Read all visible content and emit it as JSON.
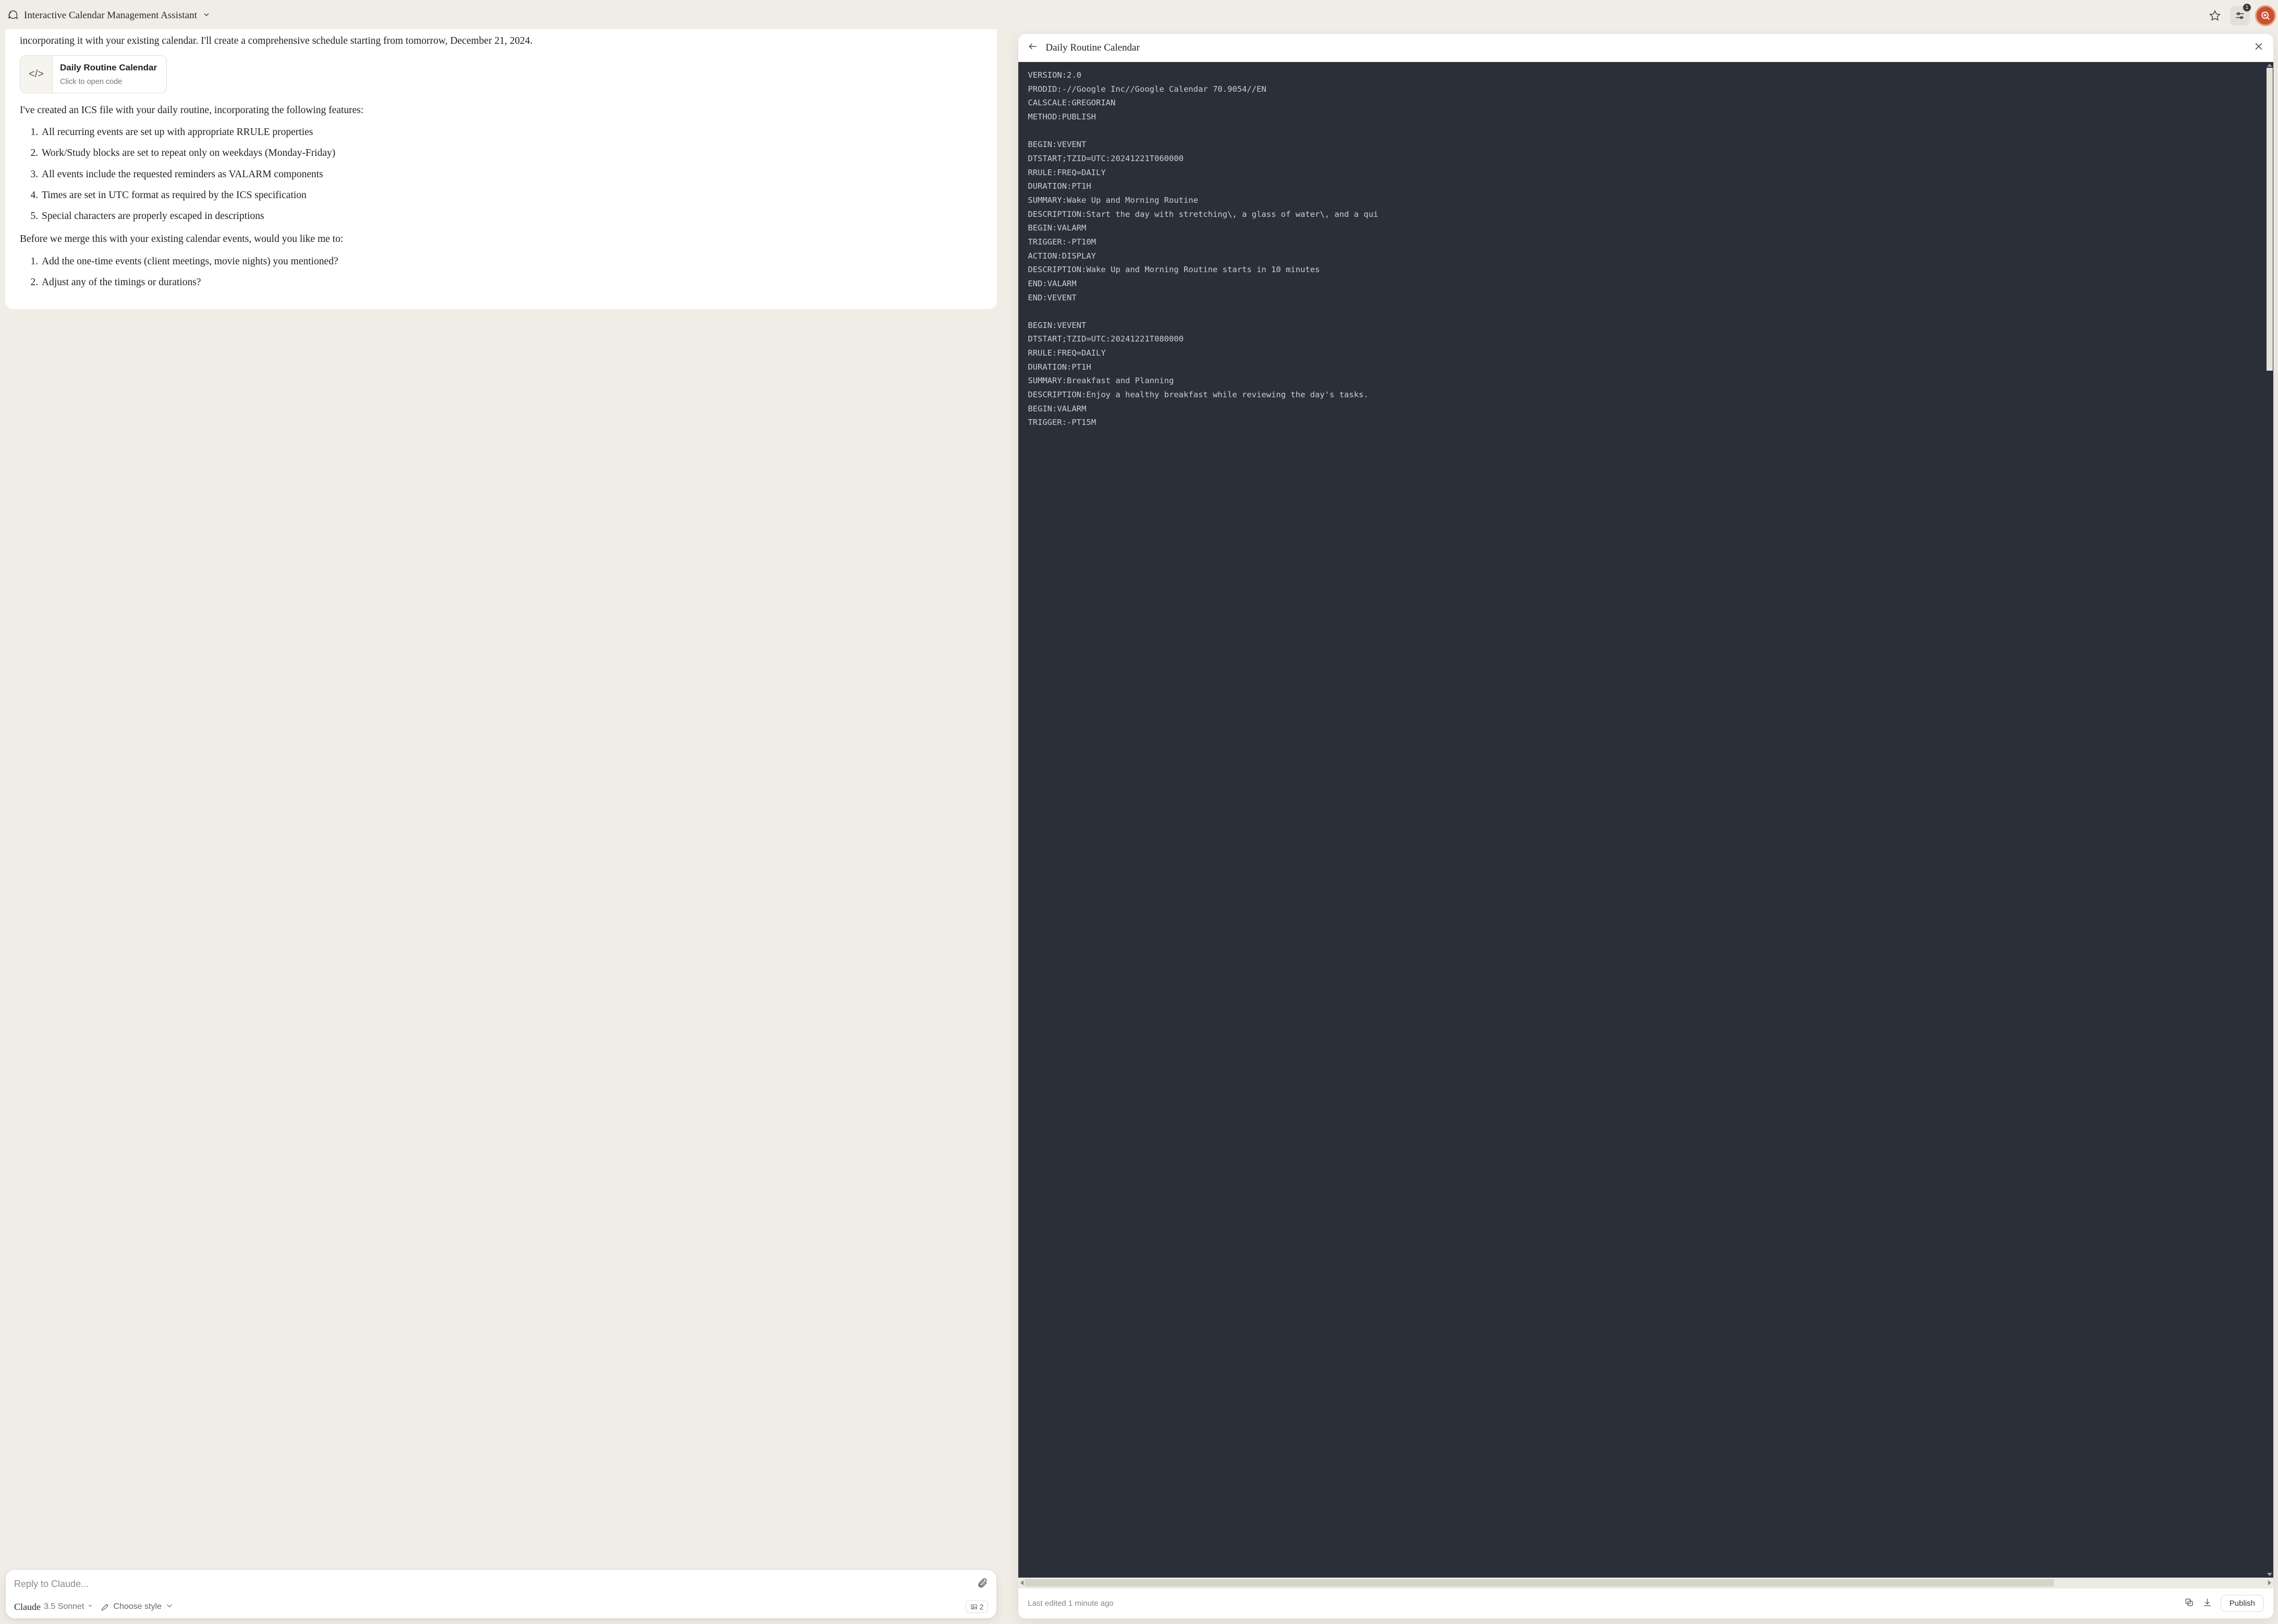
{
  "header": {
    "title": "Interactive Calendar Management Assistant",
    "settings_badge": "1"
  },
  "chat": {
    "intro_partial": "incorporating it with your existing calendar. I'll create a comprehensive schedule starting from tomorrow, December 21, 2024.",
    "artifact_chip": {
      "title": "Daily Routine Calendar",
      "subtitle": "Click to open code"
    },
    "after_chip": "I've created an ICS file with your daily routine, incorporating the following features:",
    "features": [
      "All recurring events are set up with appropriate RRULE properties",
      "Work/Study blocks are set to repeat only on weekdays (Monday-Friday)",
      "All events include the requested reminders as VALARM components",
      "Times are set in UTC format as required by the ICS specification",
      "Special characters are properly escaped in descriptions"
    ],
    "followup_intro": "Before we merge this with your existing calendar events, would you like me to:",
    "followups": [
      "Add the one-time events (client meetings, movie nights) you mentioned?",
      "Adjust any of the timings or durations?"
    ]
  },
  "composer": {
    "placeholder": "Reply to Claude...",
    "model_name": "Claude",
    "model_version": "3.5 Sonnet",
    "style_label": "Choose style",
    "image_count": "2"
  },
  "artifact": {
    "title": "Daily Routine Calendar",
    "last_edited": "Last edited 1 minute ago",
    "publish_label": "Publish",
    "code": "VERSION:2.0\nPRODID:-//Google Inc//Google Calendar 70.9054//EN\nCALSCALE:GREGORIAN\nMETHOD:PUBLISH\n\nBEGIN:VEVENT\nDTSTART;TZID=UTC:20241221T060000\nRRULE:FREQ=DAILY\nDURATION:PT1H\nSUMMARY:Wake Up and Morning Routine\nDESCRIPTION:Start the day with stretching\\, a glass of water\\, and a qui\nBEGIN:VALARM\nTRIGGER:-PT10M\nACTION:DISPLAY\nDESCRIPTION:Wake Up and Morning Routine starts in 10 minutes\nEND:VALARM\nEND:VEVENT\n\nBEGIN:VEVENT\nDTSTART;TZID=UTC:20241221T080000\nRRULE:FREQ=DAILY\nDURATION:PT1H\nSUMMARY:Breakfast and Planning\nDESCRIPTION:Enjoy a healthy breakfast while reviewing the day's tasks.\nBEGIN:VALARM\nTRIGGER:-PT15M"
  }
}
